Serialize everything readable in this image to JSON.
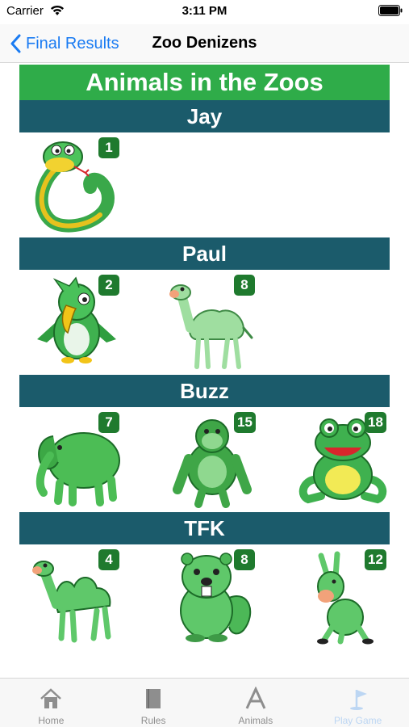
{
  "status_bar": {
    "carrier": "Carrier",
    "time": "3:11 PM"
  },
  "nav": {
    "back_label": "Final Results",
    "title": "Zoo Denizens"
  },
  "main_header": "Animals in the Zoos",
  "players": [
    {
      "name": "Jay",
      "animals": [
        {
          "icon": "snake",
          "count": "1"
        }
      ]
    },
    {
      "name": "Paul",
      "animals": [
        {
          "icon": "parrot",
          "count": "2"
        },
        {
          "icon": "camel",
          "count": "8"
        }
      ]
    },
    {
      "name": "Buzz",
      "animals": [
        {
          "icon": "elephant",
          "count": "7"
        },
        {
          "icon": "gorilla",
          "count": "15"
        },
        {
          "icon": "frog",
          "count": "18"
        }
      ]
    },
    {
      "name": "TFK",
      "animals": [
        {
          "icon": "bactrian-camel",
          "count": "4"
        },
        {
          "icon": "beaver",
          "count": "8"
        },
        {
          "icon": "donkey",
          "count": "12"
        }
      ]
    }
  ],
  "tabs": [
    {
      "label": "Home",
      "icon": "home-icon"
    },
    {
      "label": "Rules",
      "icon": "book-icon"
    },
    {
      "label": "Animals",
      "icon": "letter-a-icon"
    },
    {
      "label": "Play Game",
      "icon": "golf-flag-icon"
    }
  ],
  "colors": {
    "accent": "#1a7bf2",
    "header_green": "#2fac49",
    "player_teal": "#1b5b6b",
    "badge_green": "#1f7a2e"
  }
}
